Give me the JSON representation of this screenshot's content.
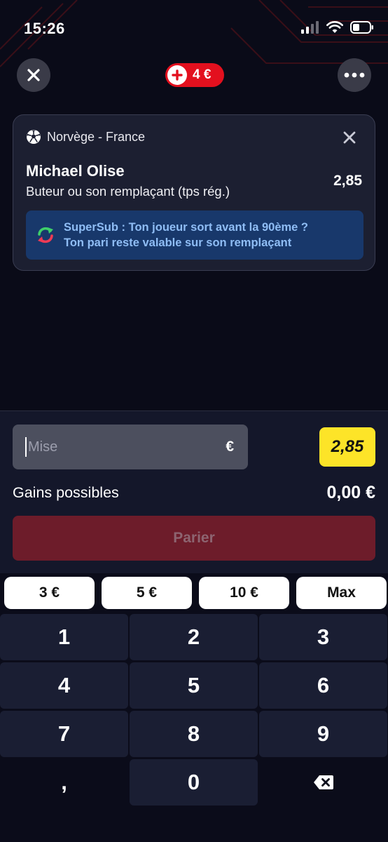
{
  "status_bar": {
    "time": "15:26"
  },
  "header": {
    "cart_amount": "4 €"
  },
  "bet": {
    "match": "Norvège - France",
    "player": "Michael Olise",
    "market": "Buteur ou son remplaçant (tps rég.)",
    "odds": "2,85",
    "supersub_line1": "SuperSub : Ton joueur sort avant la 90ème ?",
    "supersub_line2": "Ton pari reste valable sur son remplaçant"
  },
  "stake": {
    "placeholder": "Mise",
    "currency": "€",
    "odds": "2,85",
    "winnings_label": "Gains possibles",
    "winnings_value": "0,00 €",
    "bet_button": "Parier"
  },
  "quick_amounts": [
    "3 €",
    "5 €",
    "10 €",
    "Max"
  ],
  "keypad": [
    "1",
    "2",
    "3",
    "4",
    "5",
    "6",
    "7",
    "8",
    "9",
    ",",
    "0"
  ],
  "colors": {
    "background": "#0a0b18",
    "accent_red": "#e3101e",
    "odds_yellow": "#fde428",
    "supersub_blue": "#18386b",
    "bet_button_disabled": "#6d1c2a"
  }
}
